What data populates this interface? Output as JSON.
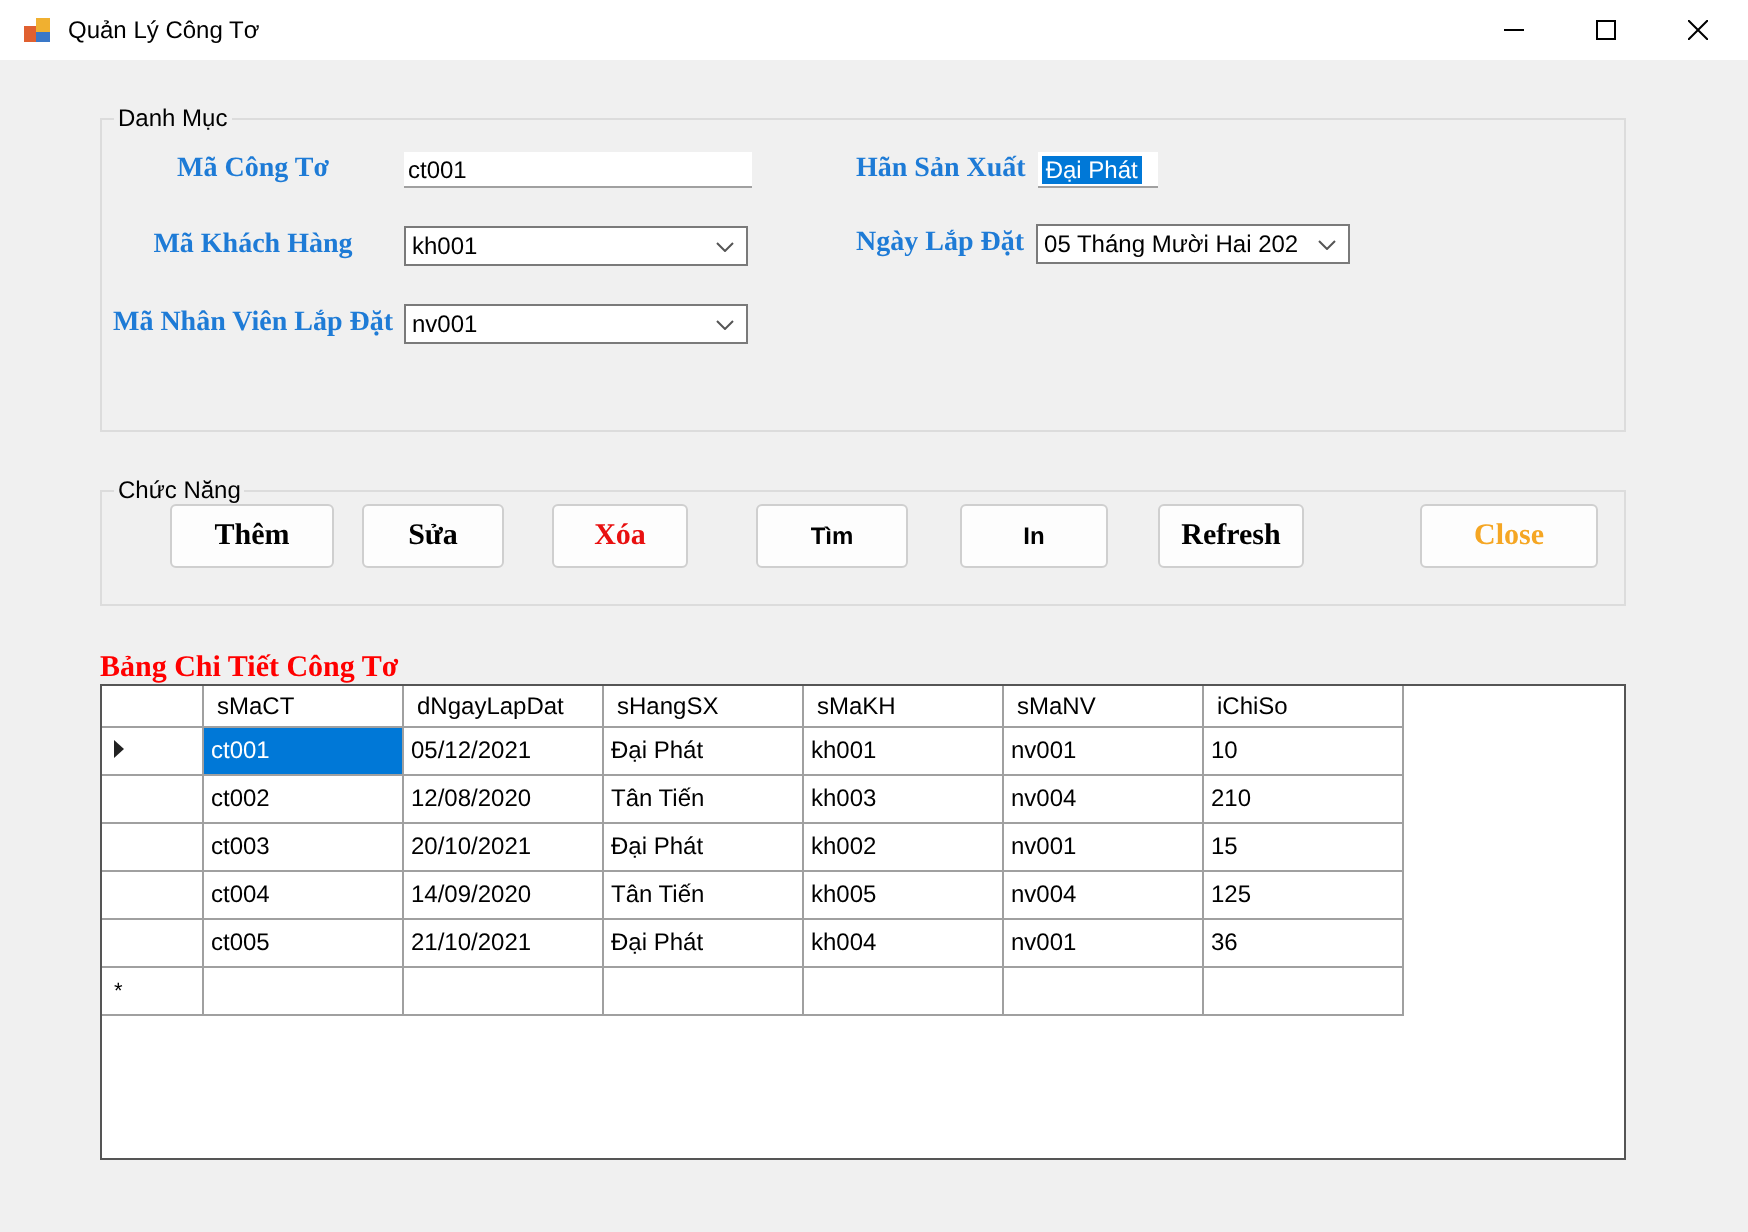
{
  "window": {
    "title": "Quản Lý Công Tơ"
  },
  "danh_muc": {
    "title": "Danh Mục",
    "left_fields": [
      {
        "label": "Mã Công Tơ",
        "kind": "text",
        "value": "ct001"
      },
      {
        "label": "Mã Khách Hàng",
        "kind": "combo",
        "value": "kh001"
      },
      {
        "label": "Mã Nhân Viên Lắp Đặt",
        "kind": "combo",
        "value": "nv001"
      }
    ],
    "right_fields": [
      {
        "label": "Hãn Sản Xuất",
        "kind": "text",
        "value": "Đại Phát",
        "text_selected": true
      },
      {
        "label": "Ngày Lắp Đặt",
        "kind": "date",
        "value": "05 Tháng Mười Hai 202"
      }
    ]
  },
  "chuc_nang": {
    "title": "Chức Năng",
    "buttons": [
      {
        "label": "Thêm",
        "kind": "default"
      },
      {
        "label": "Sửa",
        "kind": "default"
      },
      {
        "label": "Xóa",
        "kind": "danger"
      },
      {
        "label": "Tìm",
        "kind": "plain"
      },
      {
        "label": "In",
        "kind": "plain"
      },
      {
        "label": "Refresh",
        "kind": "default"
      },
      {
        "label": "Close",
        "kind": "close"
      }
    ]
  },
  "table": {
    "title": "Bảng Chi Tiết Công Tơ",
    "columns": [
      "sMaCT",
      "dNgayLapDat",
      "sHangSX",
      "sMaKH",
      "sMaNV",
      "iChiSo"
    ],
    "rows": [
      {
        "selected": true,
        "cells": [
          "ct001",
          "05/12/2021",
          "Đại Phát",
          "kh001",
          "nv001",
          "10"
        ]
      },
      {
        "selected": false,
        "cells": [
          "ct002",
          "12/08/2020",
          "Tân Tiến",
          "kh003",
          "nv004",
          "210"
        ]
      },
      {
        "selected": false,
        "cells": [
          "ct003",
          "20/10/2021",
          "Đại Phát",
          "kh002",
          "nv001",
          "15"
        ]
      },
      {
        "selected": false,
        "cells": [
          "ct004",
          "14/09/2020",
          "Tân Tiến",
          "kh005",
          "nv004",
          "125"
        ]
      },
      {
        "selected": false,
        "cells": [
          "ct005",
          "21/10/2021",
          "Đại Phát",
          "kh004",
          "nv001",
          "36"
        ]
      }
    ],
    "new_row_marker": "*"
  }
}
